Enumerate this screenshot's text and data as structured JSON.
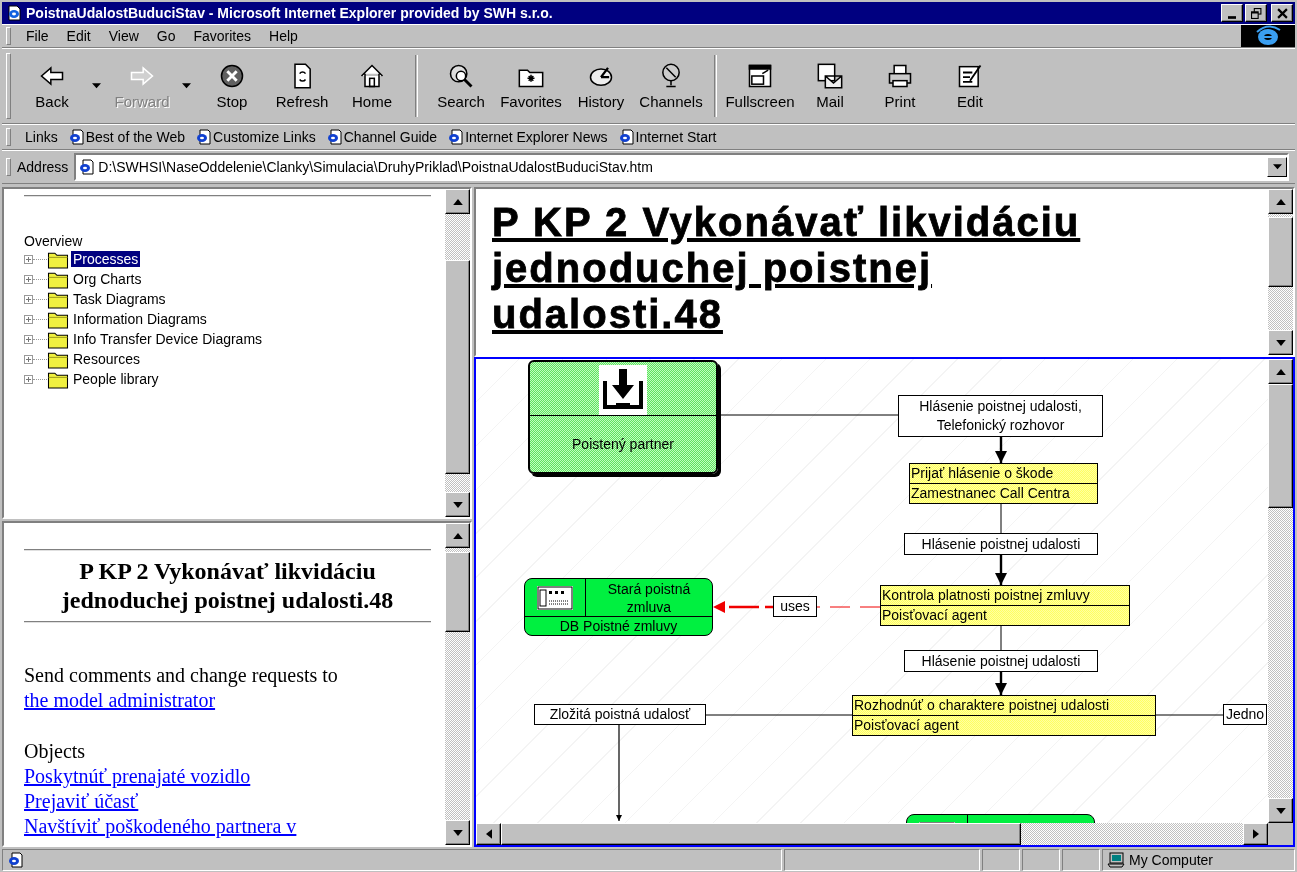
{
  "window": {
    "title": "PoistnaUdalostBuduciStav - Microsoft Internet Explorer provided by SWH s.r.o."
  },
  "menu": [
    "File",
    "Edit",
    "View",
    "Go",
    "Favorites",
    "Help"
  ],
  "toolbar": [
    [
      {
        "label": "Back",
        "kind": "back",
        "disabled": false,
        "dropdown": true
      },
      {
        "label": "Forward",
        "kind": "forward",
        "disabled": true,
        "dropdown": true
      },
      {
        "label": "Stop",
        "kind": "stop",
        "disabled": false,
        "dropdown": false
      },
      {
        "label": "Refresh",
        "kind": "refresh",
        "disabled": false,
        "dropdown": false
      },
      {
        "label": "Home",
        "kind": "home",
        "disabled": false,
        "dropdown": false
      }
    ],
    [
      {
        "label": "Search",
        "kind": "search",
        "disabled": false,
        "dropdown": false
      },
      {
        "label": "Favorites",
        "kind": "favorites",
        "disabled": false,
        "dropdown": false
      },
      {
        "label": "History",
        "kind": "history",
        "disabled": false,
        "dropdown": false
      },
      {
        "label": "Channels",
        "kind": "channels",
        "disabled": false,
        "dropdown": false
      }
    ],
    [
      {
        "label": "Fullscreen",
        "kind": "fullscreen",
        "disabled": false,
        "dropdown": false
      },
      {
        "label": "Mail",
        "kind": "mail",
        "disabled": false,
        "dropdown": false
      },
      {
        "label": "Print",
        "kind": "print",
        "disabled": false,
        "dropdown": false
      },
      {
        "label": "Edit",
        "kind": "edit",
        "disabled": false,
        "dropdown": false
      }
    ]
  ],
  "links": {
    "label": "Links",
    "items": [
      "Best of the Web",
      "Customize Links",
      "Channel Guide",
      "Internet Explorer News",
      "Internet Start"
    ]
  },
  "address": {
    "label": "Address",
    "value": "D:\\SWHSI\\NaseOddelenie\\Clanky\\Simulacia\\DruhyPriklad\\PoistnaUdalostBuduciStav.htm"
  },
  "tree": {
    "heading": "Overview",
    "items": [
      {
        "label": "Processes",
        "selected": true
      },
      {
        "label": "Org Charts",
        "selected": false
      },
      {
        "label": "Task Diagrams",
        "selected": false
      },
      {
        "label": "Information Diagrams",
        "selected": false
      },
      {
        "label": "Info Transfer Device Diagrams",
        "selected": false
      },
      {
        "label": "Resources",
        "selected": false
      },
      {
        "label": "People library",
        "selected": false
      }
    ]
  },
  "summary": {
    "title": "P KP 2 Vykonávať likvidáciu jednoduchej poistnej udalosti.48",
    "comment": "Send comments and change requests to",
    "admin_link": "the model administrator",
    "objects_heading": "Objects",
    "objects": [
      "Poskytnúť prenajaté vozidlo",
      "Prejaviť účasť",
      "Navštíviť poškodeného partnera v"
    ]
  },
  "diagram_title": "P KP 2 Vykonávať likvidáciu jednoduchej poistnej udalosti.48",
  "diagram": {
    "nodes": [
      {
        "kind": "external",
        "label": "Poistený partner"
      },
      {
        "kind": "flow",
        "label": "Hlásenie poistnej udalosti,\nTelefonický rozhovor"
      },
      {
        "kind": "activity",
        "title": "Prijať hlásenie o škode",
        "performer": "Zamestnanec Call Centra"
      },
      {
        "kind": "flow",
        "label": "Hlásenie poistnej udalosti"
      },
      {
        "kind": "database",
        "title": "Stará poistná zmluva",
        "label": "DB Poistné zmluvy"
      },
      {
        "kind": "flow",
        "label": "uses"
      },
      {
        "kind": "activity",
        "title": "Kontrola platnosti poistnej zmluvy",
        "performer": "Poisťovací agent"
      },
      {
        "kind": "flow",
        "label": "Hlásenie poistnej udalosti"
      },
      {
        "kind": "flow",
        "label": "Zložitá poistná udalosť"
      },
      {
        "kind": "activity",
        "title": "Rozhodnúť o charaktere poistnej udalosti",
        "performer": "Poisťovací agent"
      },
      {
        "kind": "flow",
        "label": "Jedno"
      },
      {
        "kind": "database"
      }
    ]
  },
  "status_bar": {
    "zone": "My Computer"
  }
}
